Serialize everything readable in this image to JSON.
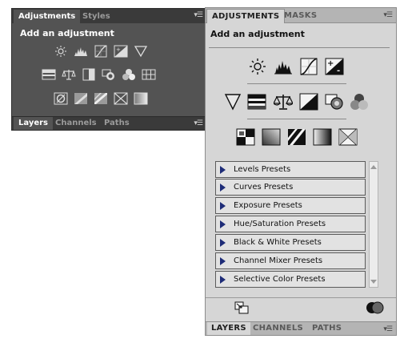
{
  "dark_panel": {
    "tabs": [
      "Adjustments",
      "Styles"
    ],
    "title": "Add an adjustment",
    "bottom_tabs": [
      "Layers",
      "Channels",
      "Paths"
    ],
    "menu_icon": "panel-menu-icon",
    "icons": [
      "brightness-contrast-icon",
      "levels-icon",
      "curves-icon",
      "exposure-icon",
      "vibrance-icon",
      "hue-saturation-icon",
      "color-balance-icon",
      "black-white-icon",
      "photo-filter-icon",
      "channel-mixer-icon",
      "color-lookup-icon",
      "invert-icon",
      "posterize-icon",
      "threshold-icon",
      "selective-color-icon",
      "gradient-map-icon"
    ]
  },
  "light_panel": {
    "tabs": [
      "ADJUSTMENTS",
      "MASKS"
    ],
    "title": "Add an adjustment",
    "bottom_tabs": [
      "LAYERS",
      "CHANNELS",
      "PATHS"
    ],
    "menu_icon": "panel-menu-icon",
    "icons_row1": [
      "brightness-contrast-icon",
      "levels-icon",
      "curves-icon",
      "exposure-icon"
    ],
    "icons_row2": [
      "vibrance-icon",
      "hue-saturation-icon",
      "color-balance-icon",
      "black-white-icon",
      "photo-filter-icon",
      "channel-mixer-icon"
    ],
    "icons_row3": [
      "invert-icon",
      "posterize-icon",
      "threshold-icon",
      "gradient-map-icon",
      "selective-color-icon"
    ],
    "presets": [
      "Levels Presets",
      "Curves Presets",
      "Exposure Presets",
      "Hue/Saturation Presets",
      "Black & White Presets",
      "Channel Mixer Presets",
      "Selective Color Presets"
    ],
    "footer_icons": [
      "expand-view-icon",
      "clip-layer-icon"
    ]
  },
  "colors": {
    "dark_panel_bg": "#535353",
    "light_panel_bg": "#d6d6d6",
    "preset_arrow": "#1e2c78"
  }
}
